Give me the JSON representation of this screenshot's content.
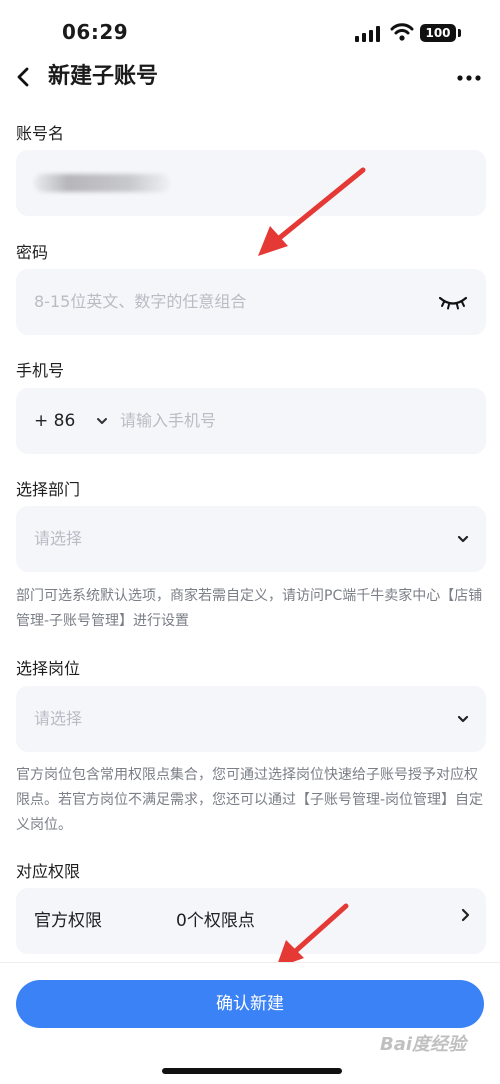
{
  "status_bar": {
    "time": "06:29",
    "battery": "100"
  },
  "nav": {
    "title": "新建子账号"
  },
  "account": {
    "label": "账号名"
  },
  "password": {
    "label": "密码",
    "placeholder": "8-15位英文、数字的任意组合"
  },
  "phone": {
    "label": "手机号",
    "country_code": "+ 86",
    "placeholder": "请输入手机号"
  },
  "department": {
    "label": "选择部门",
    "placeholder": "请选择",
    "hint": "部门可选系统默认选项，商家若需自定义，请访问PC端千牛卖家中心【店铺管理-子账号管理】进行设置"
  },
  "position": {
    "label": "选择岗位",
    "placeholder": "请选择",
    "hint": "官方岗位包含常用权限点集合，您可通过选择岗位快速给子账号授予对应权限点。若官方岗位不满足需求，您还可以通过【子账号管理-岗位管理】自定义岗位。"
  },
  "permissions": {
    "label": "对应权限",
    "row_label": "官方权限",
    "row_value": "0个权限点"
  },
  "footer": {
    "confirm_label": "确认新建"
  },
  "watermark": "Bai度经验",
  "colors": {
    "accent": "#3b82f6",
    "field_bg": "#f5f6fa",
    "annotation": "#e53935"
  }
}
